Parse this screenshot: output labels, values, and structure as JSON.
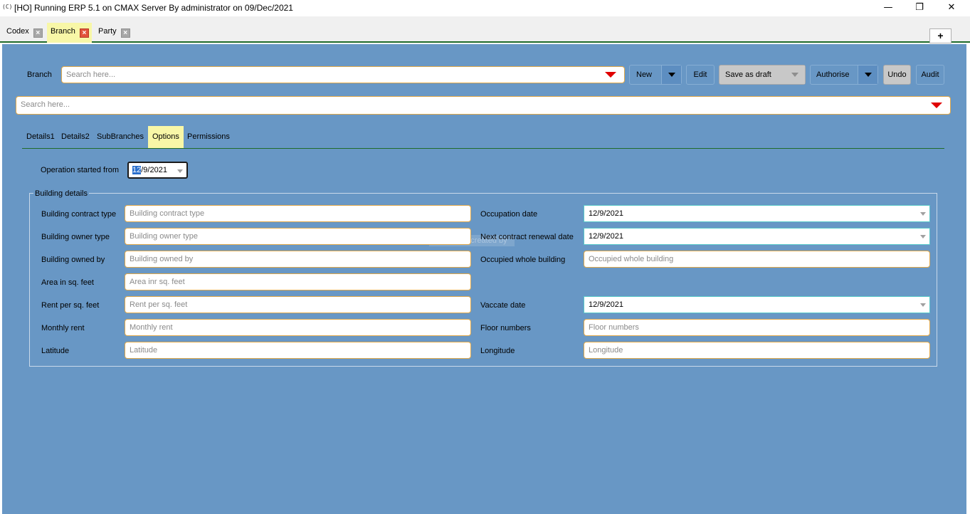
{
  "window": {
    "icon_text": "(C)",
    "title": "[HO] Running ERP 5.1 on CMAX Server By administrator on 09/Dec/2021",
    "minimize": "—",
    "restore": "❐",
    "close": "✕"
  },
  "doc_tabs": [
    {
      "label": "Codex",
      "active": false
    },
    {
      "label": "Branch",
      "active": true
    },
    {
      "label": "Party",
      "active": false
    }
  ],
  "tab_close_glyph": "×",
  "add_tab_label": "+",
  "toolbar": {
    "branch_label": "Branch",
    "branch_search_placeholder": "Search here...",
    "new_label": "New",
    "edit_label": "Edit",
    "save_draft_label": "Save as draft",
    "authorise_label": "Authorise",
    "undo_label": "Undo",
    "audit_label": "Audit"
  },
  "secondary_search_placeholder": "Search here...",
  "sub_tabs": [
    {
      "label": "Details1",
      "active": false
    },
    {
      "label": "Details2",
      "active": false
    },
    {
      "label": "SubBranches",
      "active": false
    },
    {
      "label": "Options",
      "active": true
    },
    {
      "label": "Permissions",
      "active": false
    }
  ],
  "operation": {
    "label": "Operation started from",
    "selected_part": "12",
    "rest": "/9/2021"
  },
  "building": {
    "legend": "Building details",
    "ghost_text": "Fully created by",
    "left": [
      {
        "label": "Building contract type",
        "placeholder": "Building contract type"
      },
      {
        "label": "Building owner type",
        "placeholder": "Building owner type"
      },
      {
        "label": "Building owned by",
        "placeholder": "Building owned by"
      },
      {
        "label": "Area in sq. feet",
        "placeholder": "Area inr sq. feet"
      },
      {
        "label": "Rent per sq. feet",
        "placeholder": "Rent per sq. feet"
      },
      {
        "label": "Monthly rent",
        "placeholder": "Monthly rent"
      },
      {
        "label": "Latitude",
        "placeholder": "Latitude"
      }
    ],
    "right": {
      "occupation_date": {
        "label": "Occupation date",
        "value": "12/9/2021"
      },
      "next_renewal": {
        "label": "Next contract renewal date",
        "value": "12/9/2021"
      },
      "occupied_whole": {
        "label": "Occupied whole building",
        "placeholder": "Occupied whole building"
      },
      "vaccate_date": {
        "label": "Vaccate date",
        "value": "12/9/2021"
      },
      "floor_numbers": {
        "label": "Floor numbers",
        "placeholder": "Floor numbers"
      },
      "longitude": {
        "label": "Longitude",
        "placeholder": "Longitude"
      }
    }
  },
  "colors": {
    "panel": "#6897c5",
    "active_tab": "#f8f7a7",
    "field_border": "#e0a84a",
    "date_border": "#58c8c8",
    "accent_green": "#1f6b2a",
    "dropdown_red": "#e00000"
  }
}
